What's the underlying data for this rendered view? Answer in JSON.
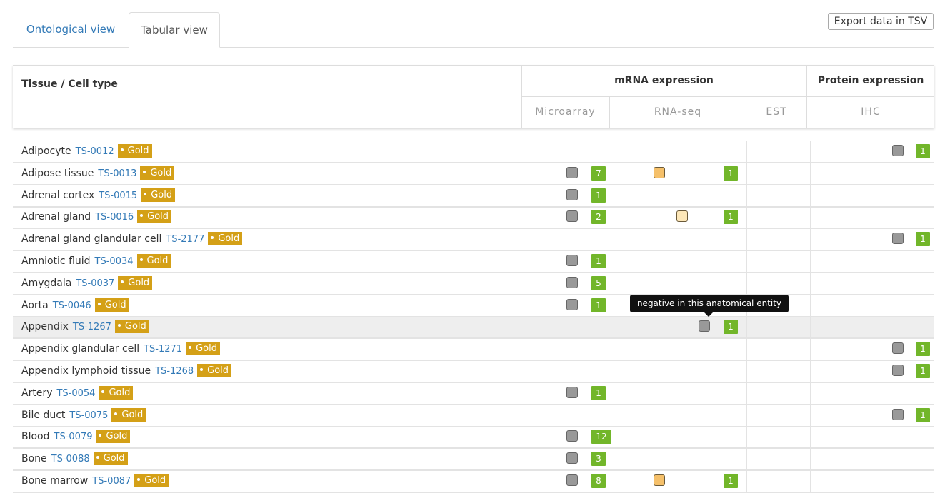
{
  "tabs": [
    {
      "label": "Ontological view",
      "active": false
    },
    {
      "label": "Tabular view",
      "active": true
    }
  ],
  "export_label": "Export data in TSV",
  "table": {
    "tissue_header": "Tissue / Cell type",
    "groups": [
      {
        "label": "mRNA expression"
      },
      {
        "label": "Protein expression"
      }
    ],
    "subcolumns": [
      "Microarray",
      "RNA-seq",
      "EST",
      "IHC"
    ],
    "badge": "Gold",
    "rows": [
      {
        "name": "Adipocyte",
        "id": "TS-0012",
        "ihc": {
          "sq": "neg",
          "count": "1"
        }
      },
      {
        "name": "Adipose tissue",
        "id": "TS-0013",
        "microarray": {
          "sq": "neg",
          "count": "7"
        },
        "rnaseq": {
          "sq": "mid",
          "count": "1"
        }
      },
      {
        "name": "Adrenal cortex",
        "id": "TS-0015",
        "microarray": {
          "sq": "neg",
          "count": "1"
        }
      },
      {
        "name": "Adrenal gland",
        "id": "TS-0016",
        "microarray": {
          "sq": "neg",
          "count": "2"
        },
        "rnaseq": {
          "sq": "low",
          "count": "1",
          "sqpos": 87
        }
      },
      {
        "name": "Adrenal gland glandular cell",
        "id": "TS-2177",
        "ihc": {
          "sq": "neg",
          "count": "1"
        }
      },
      {
        "name": "Amniotic fluid",
        "id": "TS-0034",
        "microarray": {
          "sq": "neg",
          "count": "1"
        }
      },
      {
        "name": "Amygdala",
        "id": "TS-0037",
        "microarray": {
          "sq": "neg",
          "count": "5"
        }
      },
      {
        "name": "Aorta",
        "id": "TS-0046",
        "microarray": {
          "sq": "neg",
          "count": "1"
        }
      },
      {
        "name": "Appendix",
        "id": "TS-1267",
        "hover": true,
        "rnaseq": {
          "sq": "neg",
          "count": "1",
          "sqpos": 118
        }
      },
      {
        "name": "Appendix glandular cell",
        "id": "TS-1271",
        "ihc": {
          "sq": "neg",
          "count": "1"
        }
      },
      {
        "name": "Appendix lymphoid tissue",
        "id": "TS-1268",
        "ihc": {
          "sq": "neg",
          "count": "1"
        }
      },
      {
        "name": "Artery",
        "id": "TS-0054",
        "microarray": {
          "sq": "neg",
          "count": "1"
        }
      },
      {
        "name": "Bile duct",
        "id": "TS-0075",
        "ihc": {
          "sq": "neg",
          "count": "1"
        }
      },
      {
        "name": "Blood",
        "id": "TS-0079",
        "microarray": {
          "sq": "neg",
          "count": "12"
        }
      },
      {
        "name": "Bone",
        "id": "TS-0088",
        "microarray": {
          "sq": "neg",
          "count": "3"
        }
      },
      {
        "name": "Bone marrow",
        "id": "TS-0087",
        "microarray": {
          "sq": "neg",
          "count": "8"
        },
        "rnaseq": {
          "sq": "mid",
          "count": "1"
        }
      }
    ]
  },
  "tooltip": "negative in this anatomical entity",
  "colors": {
    "link": "#337ab7",
    "gold_badge": "#d4a017",
    "count_badge": "#72b62a",
    "negative": "#999999"
  }
}
